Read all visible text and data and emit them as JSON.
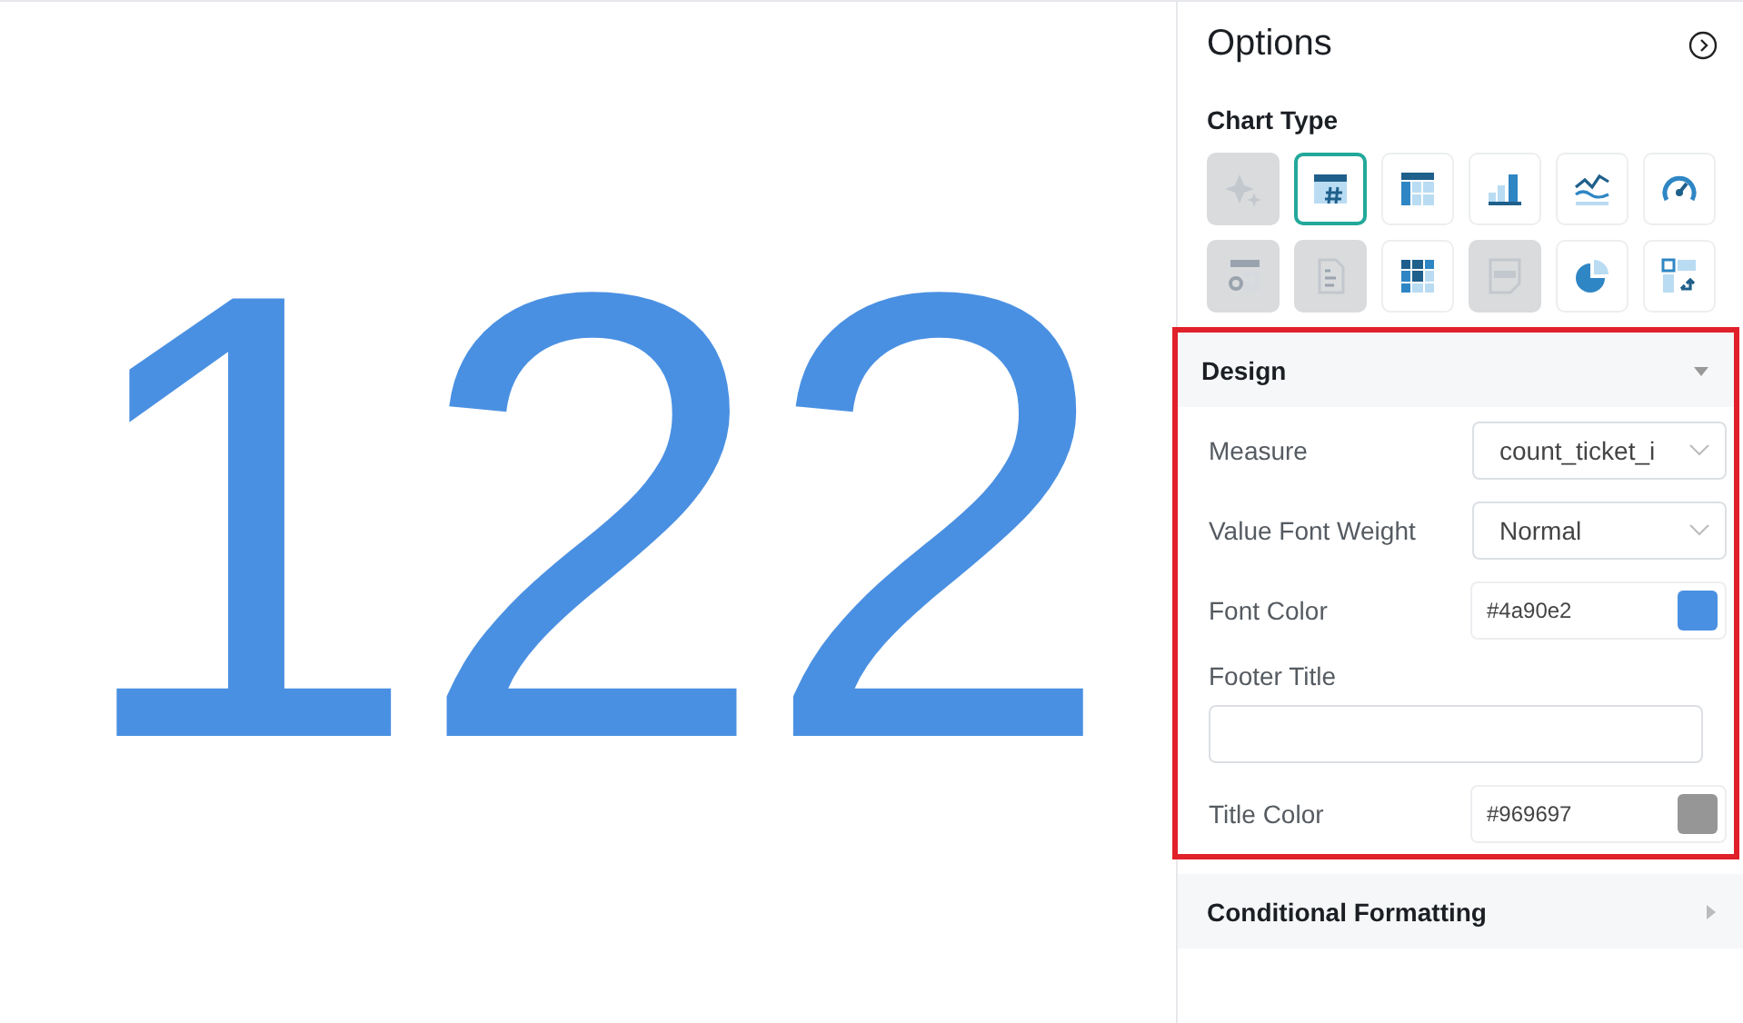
{
  "value_display": {
    "value": "122",
    "color": "#4a90e2"
  },
  "options": {
    "title": "Options",
    "chart_type": {
      "label": "Chart Type",
      "types": [
        {
          "kind": "sparkle",
          "selected": false,
          "disabled": true
        },
        {
          "kind": "number",
          "selected": true,
          "disabled": false
        },
        {
          "kind": "table",
          "selected": false,
          "disabled": false
        },
        {
          "kind": "bar",
          "selected": false,
          "disabled": false
        },
        {
          "kind": "line",
          "selected": false,
          "disabled": false
        },
        {
          "kind": "gauge",
          "selected": false,
          "disabled": false
        },
        {
          "kind": "table-settings",
          "selected": false,
          "disabled": true
        },
        {
          "kind": "document",
          "selected": false,
          "disabled": true
        },
        {
          "kind": "heatmap",
          "selected": false,
          "disabled": false
        },
        {
          "kind": "html",
          "selected": false,
          "disabled": true
        },
        {
          "kind": "pie",
          "selected": false,
          "disabled": false
        },
        {
          "kind": "pivot",
          "selected": false,
          "disabled": false
        }
      ]
    },
    "sections": [
      {
        "title": "Design",
        "expanded": true,
        "highlighted": true,
        "fields": [
          {
            "kind": "select",
            "label": "Measure",
            "value": "count_ticket_i"
          },
          {
            "kind": "select",
            "label": "Value Font Weight",
            "value": "Normal"
          },
          {
            "kind": "color",
            "label": "Font Color",
            "value": "#4a90e2",
            "color": "#4a90e2"
          },
          {
            "kind": "text",
            "label": "Footer Title"
          },
          {
            "kind": "color",
            "label": "Title Color",
            "value": "#969697",
            "color": "#969697"
          }
        ]
      },
      {
        "title": "Conditional Formatting",
        "expanded": false,
        "highlighted": false
      }
    ]
  }
}
